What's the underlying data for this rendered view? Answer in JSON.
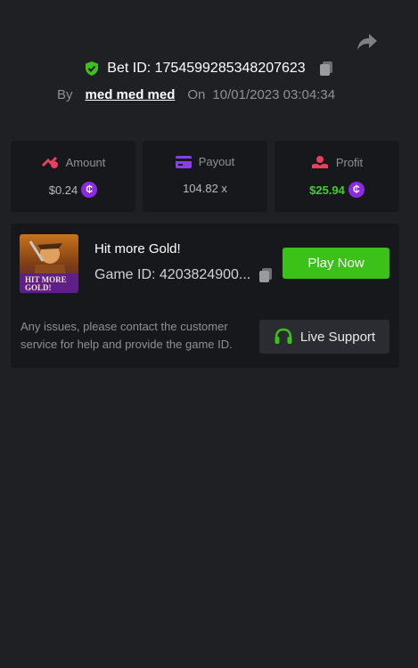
{
  "header": {
    "share_icon": "share-icon",
    "bet_id_label": "Bet ID: 1754599285348207623",
    "by_label": "By",
    "username": "med med med",
    "on_label": "On",
    "datetime": "10/01/2023 03:04:34"
  },
  "stats": [
    {
      "label": "Amount",
      "value": "$0.24",
      "icon": "amount-icon",
      "has_coin": true
    },
    {
      "label": "Payout",
      "value": "104.82 x",
      "icon": "payout-card-icon",
      "has_coin": false
    },
    {
      "label": "Profit",
      "value": "$25.94",
      "icon": "profit-hand-icon",
      "has_coin": true
    }
  ],
  "game": {
    "title": "Hit more Gold!",
    "game_id": "Game ID: 4203824900...",
    "thumb_text_line1": "HIT MORE",
    "thumb_text_line2": "GOLD!",
    "play_label": "Play Now",
    "support_text": "Any issues, please contact the customer service for help and provide the game ID.",
    "support_label": "Live Support"
  },
  "colors": {
    "background": "#1f2024",
    "card": "#17181b",
    "accent_green": "#3bc117",
    "profit_green": "#3dd12a",
    "coin_purple": "#8a2be2"
  }
}
